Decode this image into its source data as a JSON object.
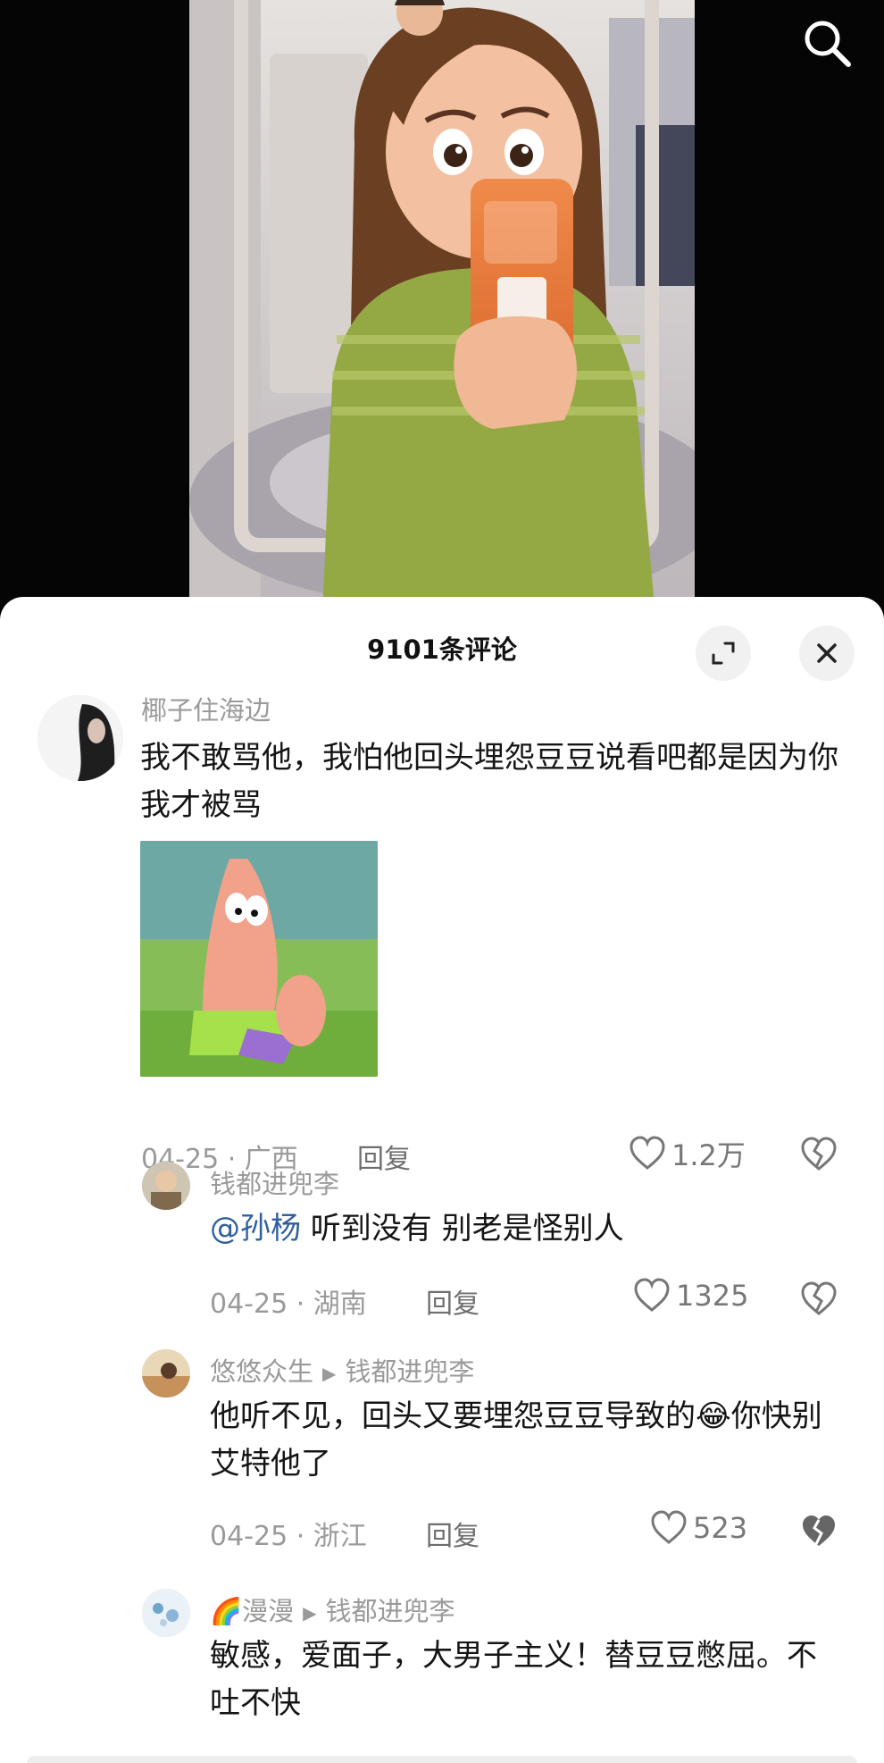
{
  "header": {
    "title": "9101条评论"
  },
  "comments": [
    {
      "user": "椰子住海边",
      "text": "我不敢骂他，我怕他回头埋怨豆豆说看吧都是因为你我才被骂",
      "date": "04-25",
      "location": "广西",
      "reply_label": "回复",
      "likes": "1.2万"
    },
    {
      "user": "钱都进兜李",
      "mention": "@孙杨",
      "text": " 听到没有 别老是怪别人",
      "date": "04-25",
      "location": "湖南",
      "reply_label": "回复",
      "likes": "1325"
    },
    {
      "user": "悠悠众生",
      "reply_to": "钱都进兜李",
      "text": "他听不见，回头又要埋怨豆豆导致的😂你快别艾特他了",
      "date": "04-25",
      "location": "浙江",
      "reply_label": "回复",
      "likes": "523"
    },
    {
      "user": "🌈漫漫",
      "reply_to": "钱都进兜李",
      "text": "敏感，爱面子，大男子主义！替豆豆憋屈。不吐不快"
    }
  ],
  "meta_separator": " · ",
  "colors": {
    "accent_link": "#2f5f9e",
    "meta_gray": "#9a9a9a",
    "sheet_bg": "#ffffff"
  }
}
